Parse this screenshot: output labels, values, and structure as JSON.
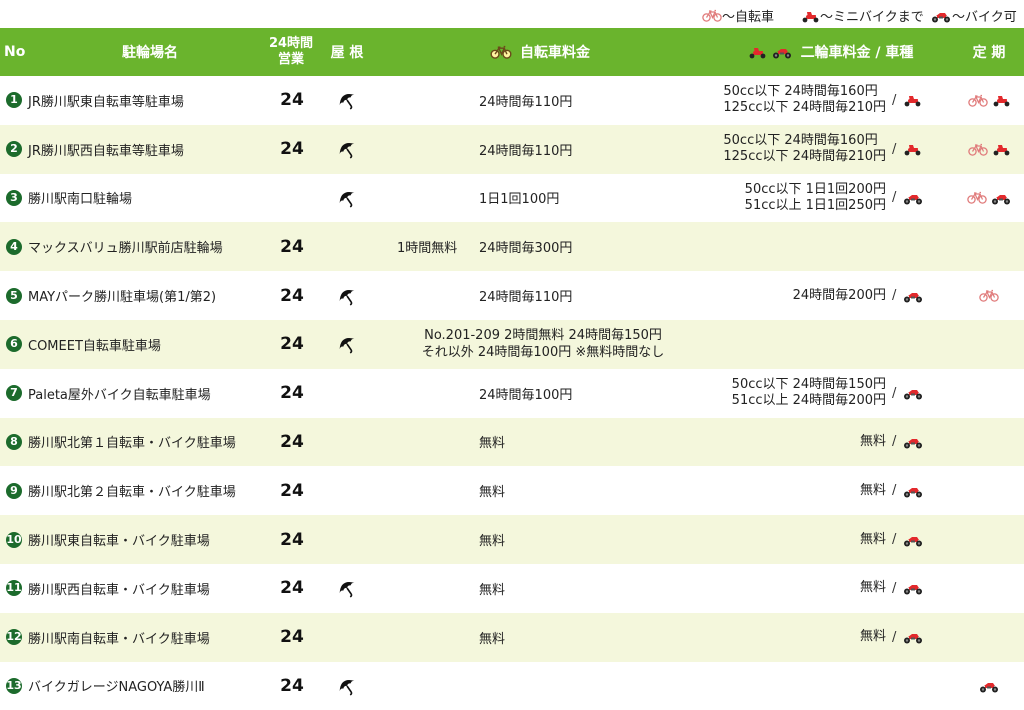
{
  "legend": {
    "bicycle_label": "～自転車",
    "minibike_label": "～ミニバイクまで",
    "bike_label": "～バイク可"
  },
  "header": {
    "no": "No",
    "name": "駐輪場名",
    "hours_line1": "24時間",
    "hours_line2": "営業",
    "roof": "屋 根",
    "bicycle_fee": "自転車料金",
    "moto_fee": "二輪車料金 / 車種",
    "pass": "定 期"
  },
  "colors": {
    "header_bg": "#6ab42d",
    "alt_row": "#f4f7dc",
    "number_badge": "#1c6b2c",
    "icon_red": "#e3292c"
  },
  "rows": [
    {
      "no": "1",
      "name": "JR勝川駅東自転車等駐車場",
      "hours": "24",
      "roof": true,
      "free": "",
      "bicycle": "24時間毎110円",
      "moto1": "50cc以下 24時間毎160円",
      "moto2": "125cc以下 24時間毎210円",
      "moto_icon": "minibike",
      "pass": [
        "bicycle",
        "minibike"
      ]
    },
    {
      "no": "2",
      "name": "JR勝川駅西自転車等駐車場",
      "hours": "24",
      "roof": true,
      "free": "",
      "bicycle": "24時間毎110円",
      "moto1": "50cc以下 24時間毎160円",
      "moto2": "125cc以下 24時間毎210円",
      "moto_icon": "minibike",
      "pass": [
        "bicycle",
        "minibike"
      ]
    },
    {
      "no": "3",
      "name": "勝川駅南口駐輪場",
      "hours": "",
      "roof": true,
      "free": "",
      "bicycle": "1日1回100円",
      "moto1": "50cc以下 1日1回200円",
      "moto2": "51cc以上 1日1回250円",
      "moto_icon": "bike",
      "pass": [
        "bicycle",
        "bike"
      ]
    },
    {
      "no": "4",
      "name": "マックスバリュ勝川駅前店駐輪場",
      "hours": "24",
      "roof": false,
      "free": "1時間無料",
      "bicycle": "24時間毎300円",
      "moto1": "",
      "moto2": "",
      "moto_icon": "",
      "pass": []
    },
    {
      "no": "5",
      "name": "MAYパーク勝川駐車場(第1/第2)",
      "hours": "24",
      "roof": true,
      "free": "",
      "bicycle": "24時間毎110円",
      "moto1": "24時間毎200円",
      "moto2": "",
      "moto_icon": "bike",
      "pass": [
        "bicycle"
      ]
    },
    {
      "no": "6",
      "name": "COMEET自転車駐車場",
      "hours": "24",
      "roof": true,
      "free": "",
      "bicycle": "",
      "bicycle_wide1": "No.201-209 2時間無料 24時間毎150円",
      "bicycle_wide2": "それ以外 24時間毎100円 ※無料時間なし",
      "moto1": "",
      "moto2": "",
      "moto_icon": "",
      "pass": []
    },
    {
      "no": "7",
      "name": "Paleta屋外バイク自転車駐車場",
      "hours": "24",
      "roof": false,
      "free": "",
      "bicycle": "24時間毎100円",
      "moto1": "50cc以下 24時間毎150円",
      "moto2": "51cc以上 24時間毎200円",
      "moto_icon": "bike",
      "pass": []
    },
    {
      "no": "8",
      "name": "勝川駅北第１自転車・バイク駐車場",
      "hours": "24",
      "roof": false,
      "free": "",
      "bicycle": "無料",
      "moto1": "無料",
      "moto2": "",
      "moto_icon": "bike",
      "pass": []
    },
    {
      "no": "9",
      "name": "勝川駅北第２自転車・バイク駐車場",
      "hours": "24",
      "roof": false,
      "free": "",
      "bicycle": "無料",
      "moto1": "無料",
      "moto2": "",
      "moto_icon": "bike",
      "pass": []
    },
    {
      "no": "10",
      "name": "勝川駅東自転車・バイク駐車場",
      "hours": "24",
      "roof": false,
      "free": "",
      "bicycle": "無料",
      "moto1": "無料",
      "moto2": "",
      "moto_icon": "bike",
      "pass": []
    },
    {
      "no": "11",
      "name": "勝川駅西自転車・バイク駐車場",
      "hours": "24",
      "roof": true,
      "free": "",
      "bicycle": "無料",
      "moto1": "無料",
      "moto2": "",
      "moto_icon": "bike",
      "pass": []
    },
    {
      "no": "12",
      "name": "勝川駅南自転車・バイク駐車場",
      "hours": "24",
      "roof": false,
      "free": "",
      "bicycle": "無料",
      "moto1": "無料",
      "moto2": "",
      "moto_icon": "bike",
      "pass": []
    },
    {
      "no": "13",
      "name": "バイクガレージNAGOYA勝川Ⅱ",
      "hours": "24",
      "roof": true,
      "free": "",
      "bicycle": "",
      "moto1": "",
      "moto2": "",
      "moto_icon": "",
      "pass": [
        "bike"
      ]
    }
  ]
}
